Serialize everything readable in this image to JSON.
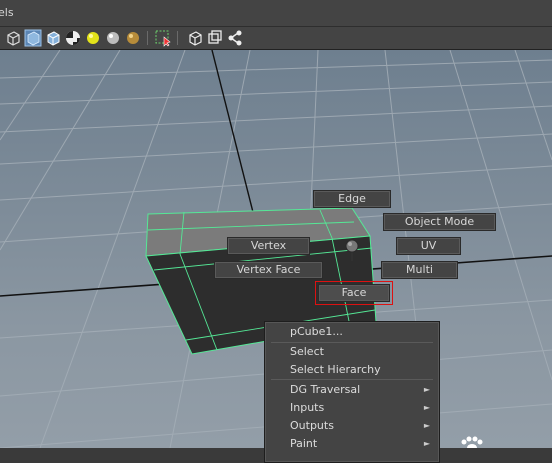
{
  "menubar": {
    "panels_label": "els"
  },
  "toolbar": {
    "icons": [
      "wireframe-cube-icon",
      "shaded-cube-icon",
      "wireframe-on-shaded-icon",
      "checker-texture-icon",
      "default-light-icon",
      "all-lights-icon",
      "shadows-icon",
      "isolate-select-icon",
      "select-camera-icon",
      "xray-icon",
      "xray-joints-icon",
      "hierarchy-icon"
    ]
  },
  "marking_menu": {
    "edge": "Edge",
    "object_mode": "Object Mode",
    "vertex": "Vertex",
    "uv": "UV",
    "vertex_face": "Vertex Face",
    "multi": "Multi",
    "face": "Face"
  },
  "context_menu": {
    "title": "pCube1...",
    "select": "Select",
    "select_hierarchy": "Select Hierarchy",
    "dg_traversal": "DG Traversal",
    "inputs": "Inputs",
    "outputs": "Outputs",
    "paint": "Paint",
    "submenu_arrow": "►"
  },
  "colors": {
    "mesh_highlight": "#55e896",
    "panel_bg": "#444444",
    "active_outline": "#dd1111"
  }
}
